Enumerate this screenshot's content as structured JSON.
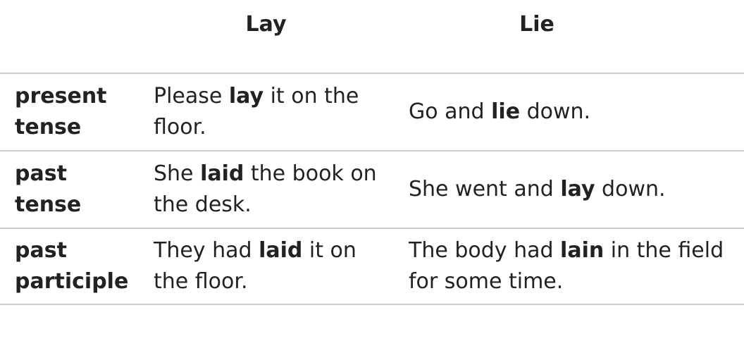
{
  "header": {
    "col1": "",
    "col2": "Lay",
    "col3": "Lie"
  },
  "rows": [
    {
      "label": "present tense",
      "lay": {
        "pre": "Please ",
        "bold": "lay",
        "post": " it on the floor."
      },
      "lie": {
        "pre": "Go and ",
        "bold": "lie",
        "post": " down."
      }
    },
    {
      "label": "past tense",
      "lay": {
        "pre": "She ",
        "bold": "laid",
        "post": " the book on the desk."
      },
      "lie": {
        "pre": "She went and ",
        "bold": "lay",
        "post": " down."
      }
    },
    {
      "label": "past participle",
      "lay": {
        "pre": "They had ",
        "bold": "laid",
        "post": " it on the floor."
      },
      "lie": {
        "pre": "The body had ",
        "bold": "lain",
        "post": " in the field for some time."
      }
    }
  ]
}
